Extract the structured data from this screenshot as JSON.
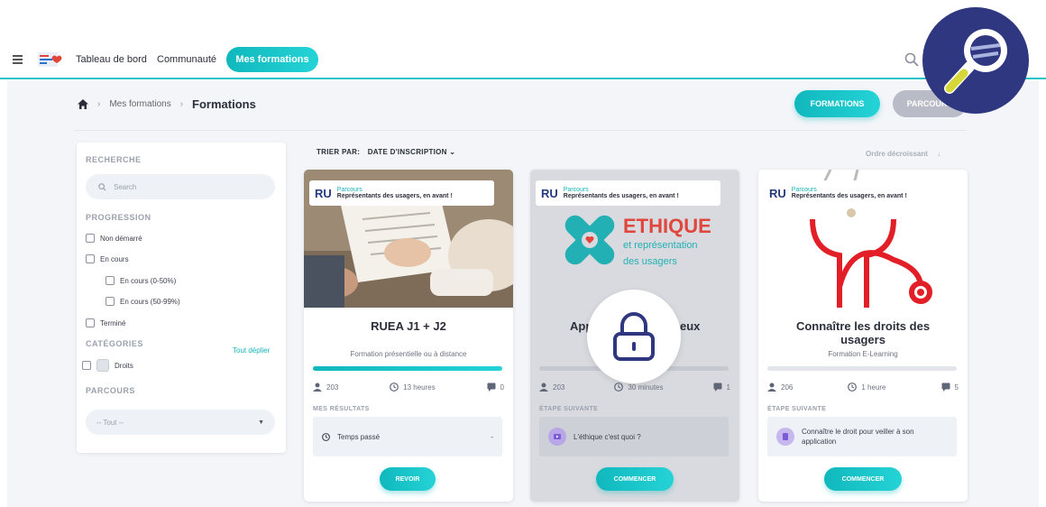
{
  "nav": {
    "items": [
      "Tableau de bord",
      "Communauté"
    ],
    "active": "Mes formations"
  },
  "breadcrumb": {
    "level1": "Mes formations",
    "current": "Formations"
  },
  "view_switch": {
    "formations": "FORMATIONS",
    "parcours": "PARCOURS"
  },
  "sort": {
    "label": "TRIER PAR:",
    "value": "DATE D'INSCRIPTION",
    "order": "Ordre décroissant"
  },
  "filters": {
    "search_title": "RECHERCHE",
    "search_placeholder": "Search",
    "progression_title": "PROGRESSION",
    "progression": [
      "Non démarré",
      "En cours",
      "En cours (0-50%)",
      "En cours (50-99%)",
      "Terminé"
    ],
    "categories_title": "CATÉGORIES",
    "expand_all": "Tout déplier",
    "categories": [
      "Droits"
    ],
    "parcours_title": "PARCOURS",
    "parcours_select": "-- Tout --"
  },
  "cards": [
    {
      "tag_kind": "Parcours",
      "tag_name": "Représentants des usagers, en avant !",
      "title": "RUEA J1 + J2",
      "subtitle": "Formation présentielle ou à distance",
      "progress": 1.0,
      "learners": "203",
      "duration": "13 heures",
      "comments": "0",
      "section": "MES RÉSULTATS",
      "box_text": "Temps passé",
      "box_value": "-",
      "cta": "REVOIR"
    },
    {
      "tag_kind": "Parcours",
      "tag_name": "Représentants des usagers, en avant !",
      "image_title": "ETHIQUE",
      "image_subtitle_1": "et représentation",
      "image_subtitle_2": "des usagers",
      "title_left": "App",
      "title_right": "eux",
      "progress": 0.0,
      "learners": "203",
      "duration": "30 minutes",
      "comments": "1",
      "section": "ÉTAPE SUIVANTE",
      "box_text": "L'éthique c'est quoi ?",
      "cta": "COMMENCER"
    },
    {
      "tag_kind": "Parcours",
      "tag_name": "Représentants des usagers, en avant !",
      "title_line1": "Connaître les droits des",
      "title_line2": "usagers",
      "subtitle": "Formation E-Learning",
      "progress": 0.0,
      "learners": "206",
      "duration": "1 heure",
      "comments": "5",
      "section": "ÉTAPE SUIVANTE",
      "box_text_1": "Connaître le droit pour veiller à son",
      "box_text_2": "application",
      "cta": "COMMENCER"
    }
  ],
  "colors": {
    "accent": "#16b3b7",
    "magnifier_bg": "#2e3780"
  }
}
